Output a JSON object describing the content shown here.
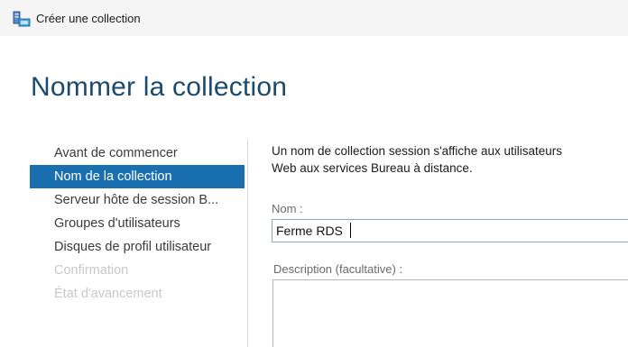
{
  "window": {
    "title": "Créer une collection",
    "icon": "server-collection-icon"
  },
  "page": {
    "heading": "Nommer la collection"
  },
  "nav": {
    "items": [
      {
        "label": "Avant de commencer",
        "state": "normal"
      },
      {
        "label": "Nom de la collection",
        "state": "active"
      },
      {
        "label": "Serveur hôte de session B...",
        "state": "normal"
      },
      {
        "label": "Groupes d'utilisateurs",
        "state": "normal"
      },
      {
        "label": "Disques de profil utilisateur",
        "state": "normal"
      },
      {
        "label": "Confirmation",
        "state": "disabled"
      },
      {
        "label": "État d'avancement",
        "state": "disabled"
      }
    ]
  },
  "content": {
    "description_line1": "Un nom de collection session s'affiche aux utilisateurs",
    "description_line2": "Web aux services Bureau à distance.",
    "name_label": "Nom :",
    "name_value": "Ferme RDS",
    "description_label": "Description (facultative) :",
    "description_value": ""
  },
  "colors": {
    "accent": "#1a6fb0",
    "heading": "#1a4a6e",
    "disabled": "#c8c8c8"
  }
}
